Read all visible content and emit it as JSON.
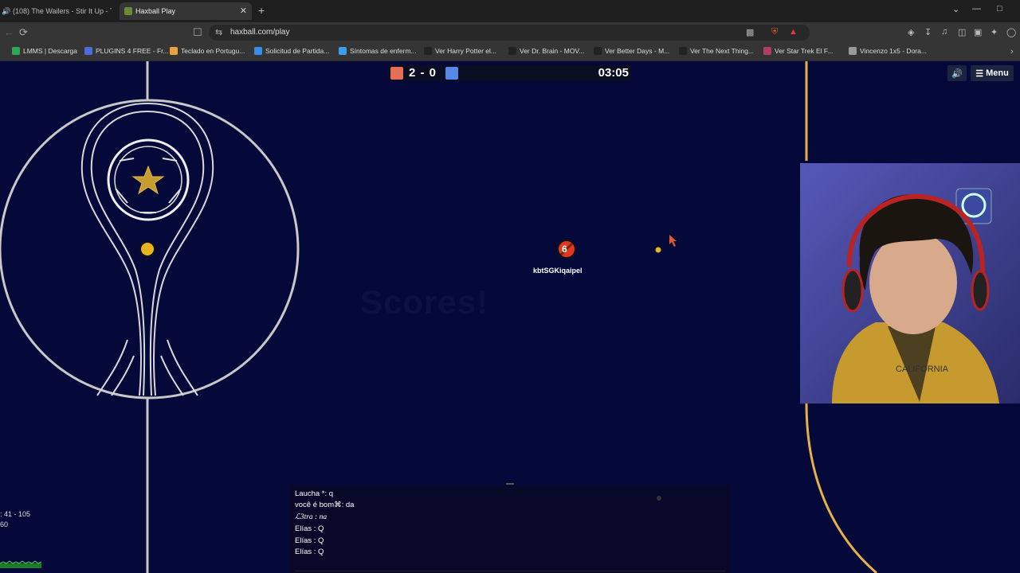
{
  "browser": {
    "tabs": [
      {
        "title": "(108) The Wailers - Stir It Up - Th",
        "active": false
      },
      {
        "title": "Haxball Play",
        "active": true
      }
    ],
    "url": "haxball.com/play",
    "bookmarks": [
      {
        "label": "LMMS | Descarga",
        "color": "#2fa84f"
      },
      {
        "label": "PLUGINS 4 FREE - Fr...",
        "color": "#4f6bd8"
      },
      {
        "label": "Teclado en Portugu...",
        "color": "#e8a33a"
      },
      {
        "label": "Solicitud de Partida...",
        "color": "#3a8ee8"
      },
      {
        "label": "Síntomas de enferm...",
        "color": "#3a9ee8"
      },
      {
        "label": "Ver Harry Potter el...",
        "color": "#222222"
      },
      {
        "label": "Ver Dr. Brain - MOV...",
        "color": "#222222"
      },
      {
        "label": "Ver Better Days - M...",
        "color": "#222222"
      },
      {
        "label": "Ver The Next Thing...",
        "color": "#222222"
      },
      {
        "label": "Ver Star Trek El F...",
        "color": "#b04060"
      },
      {
        "label": "Vincenzo 1x5 - Dora...",
        "color": "#999999"
      }
    ]
  },
  "game": {
    "score": "2 - 0",
    "timer": "03:05",
    "red_color": "#e56e56",
    "blue_color": "#5689e5",
    "menu_label": "Menu",
    "player_number": "6",
    "player_name": "kbtSGKiqaipel",
    "ghost_text": "Scores!"
  },
  "chat": {
    "lines": [
      "Laucha *: q",
      "você é bom⌘: da",
      "ℒ3tra  : na",
      "Elías : Q",
      "Elías : Q",
      "Elías : Q"
    ]
  },
  "stats": {
    "ping": ": 41 - 105",
    "fps": "60"
  }
}
